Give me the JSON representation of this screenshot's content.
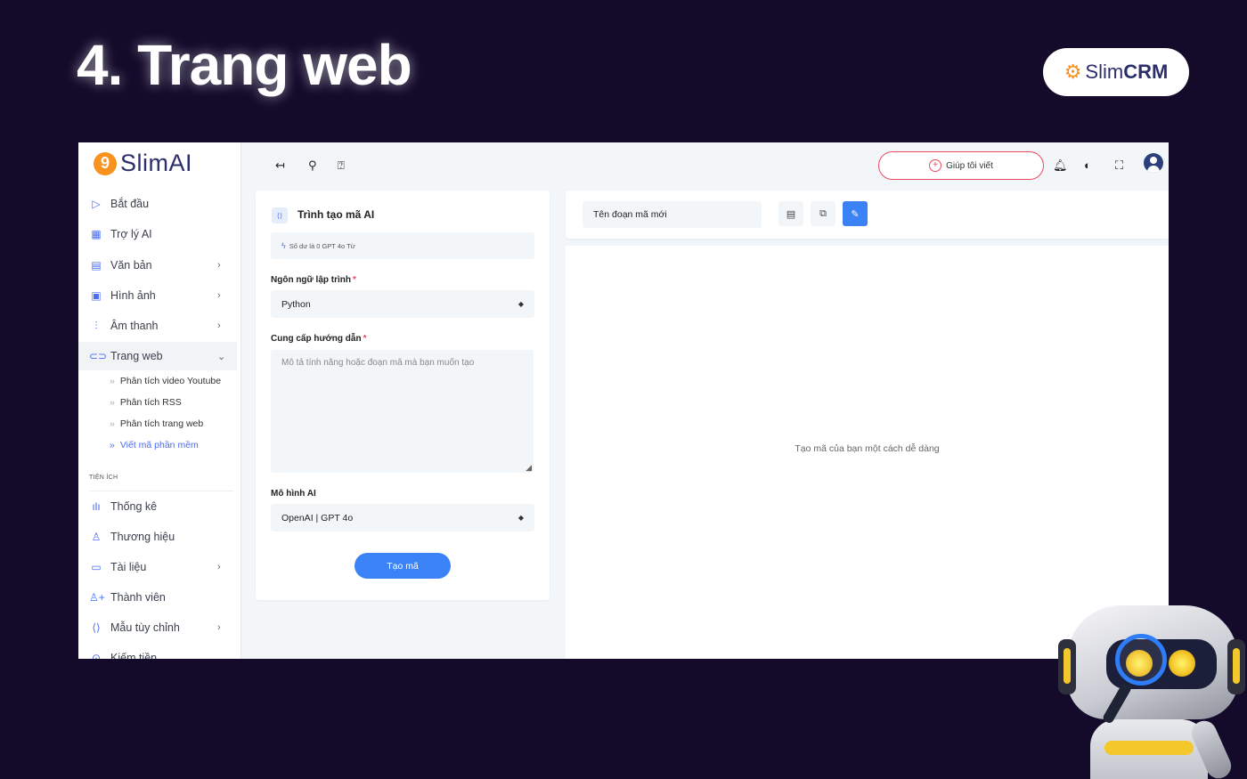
{
  "slide": {
    "title": "4. Trang web"
  },
  "brand": {
    "name_light": "Slim",
    "name_bold": "CRM"
  },
  "app": {
    "logo": {
      "mark": "9",
      "text": "SlimAI"
    },
    "sidebar": {
      "items": [
        {
          "label": "Bắt đầu",
          "icon": "play-icon",
          "chevron": ""
        },
        {
          "label": "Trợ lý AI",
          "icon": "chip-icon",
          "chevron": ""
        },
        {
          "label": "Văn bản",
          "icon": "document-icon",
          "chevron": "›"
        },
        {
          "label": "Hình ảnh",
          "icon": "image-icon",
          "chevron": "›"
        },
        {
          "label": "Âm thanh",
          "icon": "waveform-icon",
          "chevron": "›"
        },
        {
          "label": "Trang web",
          "icon": "link-icon",
          "chevron": "⌄"
        }
      ],
      "subitems": [
        {
          "label": "Phân tích video Youtube"
        },
        {
          "label": "Phân tích RSS"
        },
        {
          "label": "Phân tích trang web"
        },
        {
          "label": "Viết mã phần mềm"
        }
      ],
      "section_label": "TIỆN ÍCH",
      "utility_items": [
        {
          "label": "Thống kê",
          "icon": "bar-chart-icon",
          "chevron": ""
        },
        {
          "label": "Thương hiệu",
          "icon": "brand-icon",
          "chevron": ""
        },
        {
          "label": "Tài liệu",
          "icon": "folder-icon",
          "chevron": "›"
        },
        {
          "label": "Thành viên",
          "icon": "add-user-icon",
          "chevron": ""
        },
        {
          "label": "Mẫu tùy chỉnh",
          "icon": "code-template-icon",
          "chevron": "›"
        },
        {
          "label": "Kiếm tiền",
          "icon": "money-icon",
          "chevron": ""
        }
      ]
    },
    "topbar": {
      "help_write_label": "Giúp tôi viết"
    },
    "form": {
      "title": "Trình tạo mã AI",
      "balance": "Số dư là 0 GPT 4o Từ",
      "language_label": "Ngôn ngữ lập trình",
      "language_value": "Python",
      "instructions_label": "Cung cấp hướng dẫn",
      "instructions_placeholder": "Mô tả tính năng hoặc đoạn mã mà bạn muốn tạo",
      "model_label": "Mô hình AI",
      "model_value": "OpenAI | GPT 4o",
      "submit_label": "Tạo mã",
      "required_mark": "*"
    },
    "code_panel": {
      "name_value": "Tên đoạn mã mới",
      "empty_message": "Tạo mã của bạn một cách dễ dàng"
    }
  },
  "colors": {
    "background": "#140b2b",
    "accent": "#3b82f6",
    "brand_orange": "#f7931e",
    "required": "#e84a5f"
  }
}
